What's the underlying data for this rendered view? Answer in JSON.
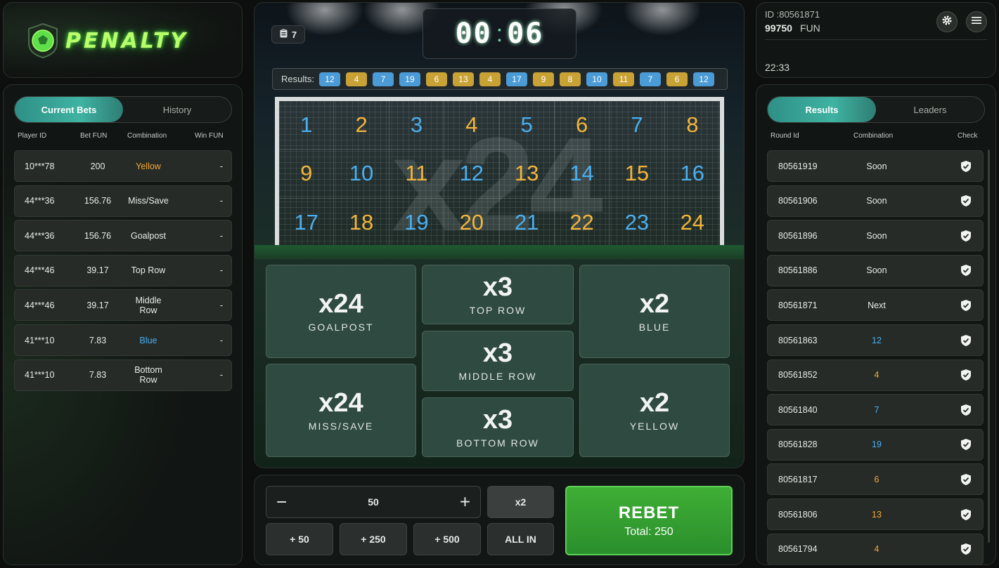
{
  "brand": {
    "logo_text": "PENALTY"
  },
  "current_bets": {
    "tabs": [
      "Current Bets",
      "History"
    ],
    "columns": [
      "Player ID",
      "Bet  FUN",
      "Combination",
      "Win  FUN"
    ],
    "rows": [
      {
        "player": "10***78",
        "bet": "200",
        "combination": "Yellow",
        "win": "-",
        "color": "gold"
      },
      {
        "player": "44***36",
        "bet": "156.76",
        "combination": "Miss/Save",
        "win": "-",
        "color": "white"
      },
      {
        "player": "44***36",
        "bet": "156.76",
        "combination": "Goalpost",
        "win": "-",
        "color": "white"
      },
      {
        "player": "44***46",
        "bet": "39.17",
        "combination": "Top Row",
        "win": "-",
        "color": "white"
      },
      {
        "player": "44***46",
        "bet": "39.17",
        "combination": "Middle Row",
        "win": "-",
        "color": "white"
      },
      {
        "player": "41***10",
        "bet": "7.83",
        "combination": "Blue",
        "win": "-",
        "color": "blue"
      },
      {
        "player": "41***10",
        "bet": "7.83",
        "combination": "Bottom Row",
        "win": "-",
        "color": "white"
      }
    ]
  },
  "game": {
    "round_count": "7",
    "timer": {
      "minutes": "00",
      "seconds": "06"
    },
    "results_label": "Results:",
    "recent_results": [
      {
        "n": "12",
        "c": "blue"
      },
      {
        "n": "4",
        "c": "gold"
      },
      {
        "n": "7",
        "c": "blue"
      },
      {
        "n": "19",
        "c": "blue"
      },
      {
        "n": "6",
        "c": "gold"
      },
      {
        "n": "13",
        "c": "gold"
      },
      {
        "n": "4",
        "c": "gold"
      },
      {
        "n": "17",
        "c": "blue"
      },
      {
        "n": "9",
        "c": "gold"
      },
      {
        "n": "8",
        "c": "gold"
      },
      {
        "n": "10",
        "c": "blue"
      },
      {
        "n": "11",
        "c": "gold"
      },
      {
        "n": "7",
        "c": "blue"
      },
      {
        "n": "6",
        "c": "gold"
      },
      {
        "n": "12",
        "c": "blue"
      }
    ],
    "goal_watermark": "x24",
    "goal_cells": [
      {
        "n": "1",
        "c": "blue"
      },
      {
        "n": "2",
        "c": "gold"
      },
      {
        "n": "3",
        "c": "blue"
      },
      {
        "n": "4",
        "c": "gold"
      },
      {
        "n": "5",
        "c": "blue"
      },
      {
        "n": "6",
        "c": "gold"
      },
      {
        "n": "7",
        "c": "blue"
      },
      {
        "n": "8",
        "c": "gold"
      },
      {
        "n": "9",
        "c": "gold"
      },
      {
        "n": "10",
        "c": "blue"
      },
      {
        "n": "11",
        "c": "gold"
      },
      {
        "n": "12",
        "c": "blue"
      },
      {
        "n": "13",
        "c": "gold"
      },
      {
        "n": "14",
        "c": "blue"
      },
      {
        "n": "15",
        "c": "gold"
      },
      {
        "n": "16",
        "c": "blue"
      },
      {
        "n": "17",
        "c": "blue"
      },
      {
        "n": "18",
        "c": "gold"
      },
      {
        "n": "19",
        "c": "blue"
      },
      {
        "n": "20",
        "c": "gold"
      },
      {
        "n": "21",
        "c": "blue"
      },
      {
        "n": "22",
        "c": "gold"
      },
      {
        "n": "23",
        "c": "blue"
      },
      {
        "n": "24",
        "c": "gold"
      }
    ],
    "bet_options": {
      "goalpost": {
        "mult": "x24",
        "label": "GOALPOST"
      },
      "miss_save": {
        "mult": "x24",
        "label": "MISS/SAVE"
      },
      "top_row": {
        "mult": "x3",
        "label": "TOP ROW"
      },
      "middle_row": {
        "mult": "x3",
        "label": "MIDDLE ROW"
      },
      "bottom_row": {
        "mult": "x3",
        "label": "BOTTOM ROW"
      },
      "blue": {
        "mult": "x2",
        "label": "BLUE"
      },
      "yellow": {
        "mult": "x2",
        "label": "YELLOW"
      }
    }
  },
  "controls": {
    "minus": "−",
    "plus": "+",
    "stake": "50",
    "double": "x2",
    "add50": "+ 50",
    "add250": "+ 250",
    "add500": "+ 500",
    "all_in": "ALL IN",
    "rebet": "REBET",
    "total": "Total: 250"
  },
  "account": {
    "id": "ID :80561871",
    "balance": "99750",
    "currency": "FUN",
    "time": "22:33"
  },
  "results_panel": {
    "tabs": [
      "Results",
      "Leaders"
    ],
    "columns": [
      "Round Id",
      "Combination",
      "Check"
    ],
    "rows": [
      {
        "round": "80561919",
        "combination": "Soon",
        "color": "white"
      },
      {
        "round": "80561906",
        "combination": "Soon",
        "color": "white"
      },
      {
        "round": "80561896",
        "combination": "Soon",
        "color": "white"
      },
      {
        "round": "80561886",
        "combination": "Soon",
        "color": "white"
      },
      {
        "round": "80561871",
        "combination": "Next",
        "color": "white"
      },
      {
        "round": "80561863",
        "combination": "12",
        "color": "blue"
      },
      {
        "round": "80561852",
        "combination": "4",
        "color": "gold"
      },
      {
        "round": "80561840",
        "combination": "7",
        "color": "blue"
      },
      {
        "round": "80561828",
        "combination": "19",
        "color": "blue"
      },
      {
        "round": "80561817",
        "combination": "6",
        "color": "gold"
      },
      {
        "round": "80561806",
        "combination": "13",
        "color": "gold"
      },
      {
        "round": "80561794",
        "combination": "4",
        "color": "gold"
      }
    ]
  }
}
